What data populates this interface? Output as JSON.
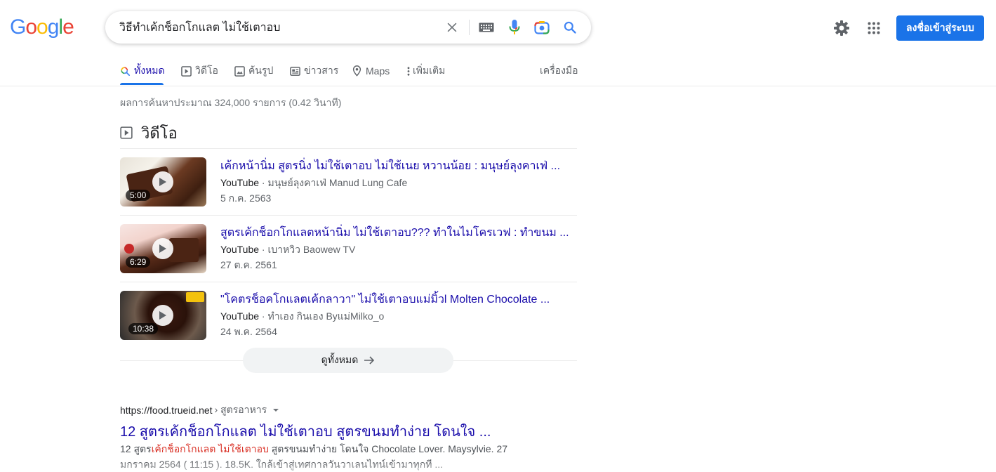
{
  "logo": {
    "text": "Google"
  },
  "search": {
    "query": "วิธีทำเค้กช็อกโกแลต ไม่ใช้เตาอบ"
  },
  "header": {
    "signin_label": "ลงชื่อเข้าสู่ระบบ"
  },
  "tabs": [
    {
      "label": "ทั้งหมด",
      "icon": "search-icon",
      "active": true
    },
    {
      "label": "วิดีโอ",
      "icon": "video-icon"
    },
    {
      "label": "ค้นรูป",
      "icon": "image-icon"
    },
    {
      "label": "ข่าวสาร",
      "icon": "news-icon"
    },
    {
      "label": "Maps",
      "icon": "map-pin-icon"
    },
    {
      "label": "เพิ่มเติม",
      "icon": "more-vert-icon"
    }
  ],
  "tools_label": "เครื่องมือ",
  "stats": "ผลการค้นหาประมาณ 324,000 รายการ (0.42 วินาที)",
  "videos": {
    "heading": "วิดีโอ",
    "items": [
      {
        "title": "เค้กหน้านิ่ม สูตรนิ่ง ไม่ใช้เตาอบ ไม่ใช้เนย หวานน้อย : มนุษย์ลุงคาเฟ่ ...",
        "source": "YouTube",
        "channel": "มนุษย์ลุงคาเฟ่ Manud Lung Cafe",
        "date": "5 ก.ค. 2563",
        "duration": "5:00"
      },
      {
        "title": "สูตรเค้กช็อกโกแลตหน้านิ่ม ไม่ใช้เตาอบ??? ทำในไมโครเวฟ : ทำขนม ...",
        "source": "YouTube",
        "channel": "เบาหวิว Baowew TV",
        "date": "27 ต.ค. 2561",
        "duration": "6:29"
      },
      {
        "title": "\"โคตรช็อคโกแลตเค้กลาวา\" ไม่ใช้เตาอบแม่มิ้วl Molten Chocolate ...",
        "source": "YouTube",
        "channel": "ทำเอง กินเอง Byแม่Milko_o",
        "date": "24 พ.ค. 2564",
        "duration": "10:38"
      }
    ],
    "see_all": "ดูทั้งหมด"
  },
  "result": {
    "site": "https://food.trueid.net",
    "path": "› สูตรอาหาร",
    "title": "12 สูตรเค้กช็อกโกแลต ไม่ใช้เตาอบ สูตรขนมทำง่าย โดนใจ ...",
    "snippet_pre": "12 สูตร",
    "snippet_em": "เค้กช็อกโกแลต ไม่ใช้เตาอบ",
    "snippet_post": " สูตรขนมทำง่าย โดนใจ Chocolate Lover. Maysylvie. 27 มกราคม 2564 ( 11:15 ). 18.5K. ใกล้เข้าสู่เทศกาลวันวาเลนไทน์เข้ามาทุกที ..."
  }
}
